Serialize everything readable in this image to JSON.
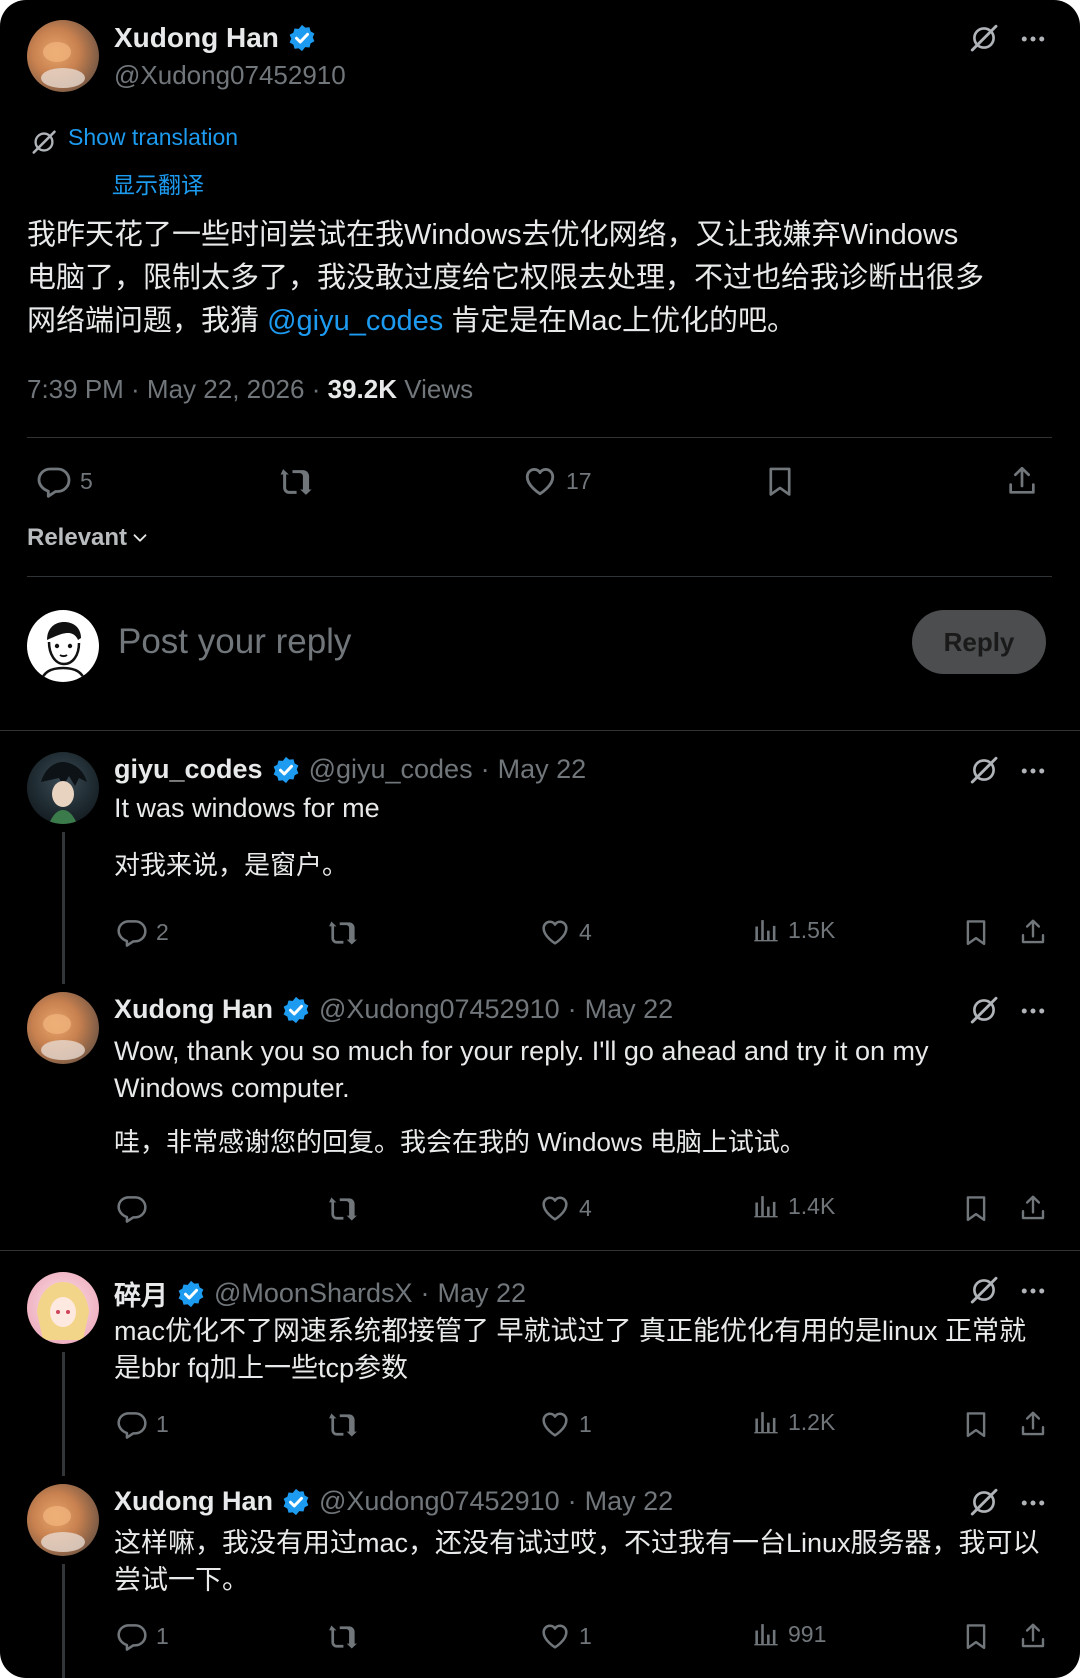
{
  "tweet": {
    "author_name": "Xudong Han",
    "author_handle": "@Xudong07452910",
    "show_translation": "Show translation",
    "translation_label": "显示翻译",
    "text_1": "我昨天花了一些时间尝试在我Windows去优化网络，又让我嫌弃Windows",
    "text_2": "电脑了，限制太多了，我没敢过度给它权限去处理，不过也给我诊断出很多",
    "text_3a": "网络端问题，我猜 ",
    "text_mention": "@giyu_codes",
    "text_3b": " 肯定是在Mac上优化的吧。",
    "time": "7:39 PM · May 22, 2026 · ",
    "views_count": "39.2K",
    "views_label": " Views",
    "replies": "5",
    "likes": "17",
    "sort_label": "Relevant"
  },
  "composer": {
    "placeholder": "Post your reply",
    "reply_button": "Reply"
  },
  "replies": [
    {
      "name": "giyu_codes",
      "handle": "@giyu_codes",
      "date": "May 22",
      "text_1": "It was windows for me",
      "translation": "对我来说，是窗户。",
      "replies": "2",
      "likes": "4",
      "views": "1.5K"
    },
    {
      "name": "Xudong Han",
      "handle": "@Xudong07452910",
      "date": "May 22",
      "text_1": "Wow, thank you so much for your reply.  I'll go ahead and try it on my",
      "text_2": "Windows computer.",
      "translation": "哇，非常感谢您的回复。我会在我的 Windows 电脑上试试。",
      "replies": "",
      "likes": "4",
      "views": "1.4K"
    },
    {
      "name": "碎月",
      "handle": "@MoonShardsX",
      "date": "May 22",
      "text_1": "mac优化不了网速系统都接管了 早就试过了 真正能优化有用的是linux 正常就",
      "text_2": "是bbr fq加上一些tcp参数",
      "replies": "1",
      "likes": "1",
      "views": "1.2K"
    },
    {
      "name": "Xudong Han",
      "handle": "@Xudong07452910",
      "date": "May 22",
      "text_1": "这样嘛，我没有用过mac，还没有试过哎，不过我有一台Linux服务器，我可以",
      "text_2": "尝试一下。",
      "replies": "1",
      "likes": "1",
      "views": "991"
    }
  ],
  "separator": " · ",
  "colors": {
    "background": "#000000",
    "text": "#e7e9ea",
    "muted": "#71767b",
    "accent": "#1d9bf0",
    "divider": "#2f3336"
  },
  "icons": [
    "grok-icon",
    "more-icon",
    "verified-badge-icon",
    "translate-icon",
    "reply-icon",
    "repost-icon",
    "like-icon",
    "bookmark-icon",
    "share-icon",
    "views-icon",
    "chevron-down-icon"
  ]
}
